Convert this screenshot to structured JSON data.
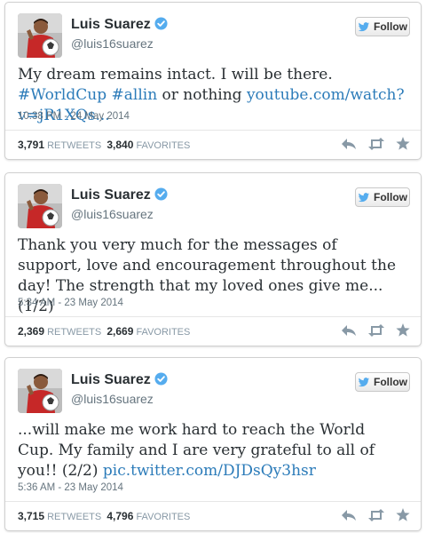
{
  "tweets": [
    {
      "name": "Luis Suarez",
      "handle": "@luis16suarez",
      "follow_label": "Follow",
      "text_parts": [
        {
          "t": "My dream remains intact. I will be there. ",
          "link": false
        },
        {
          "t": "#WorldCup",
          "link": true
        },
        {
          "t": " ",
          "link": false
        },
        {
          "t": "#allin",
          "link": true
        },
        {
          "t": " or nothing ",
          "link": false
        },
        {
          "t": "youtube.com/watch?v=jR1XQs...",
          "link": true
        }
      ],
      "timestamp": "10:38 PM - 24 May 2014",
      "retweets": "3,791",
      "retweets_label": "RETWEETS",
      "favorites": "3,840",
      "favorites_label": "FAVORITES"
    },
    {
      "name": "Luis Suarez",
      "handle": "@luis16suarez",
      "follow_label": "Follow",
      "text_parts": [
        {
          "t": "Thank you very much for the messages of support, love and encouragement throughout the day! The strength that my loved ones give me... (1/2)",
          "link": false
        }
      ],
      "timestamp": "5:34 AM - 23 May 2014",
      "retweets": "2,369",
      "retweets_label": "RETWEETS",
      "favorites": "2,669",
      "favorites_label": "FAVORITES"
    },
    {
      "name": "Luis Suarez",
      "handle": "@luis16suarez",
      "follow_label": "Follow",
      "text_parts": [
        {
          "t": "...will make me work hard to reach the World Cup. My family and I are very grateful to all of you!! (2/2) ",
          "link": false
        },
        {
          "t": "pic.twitter.com/DJDsQy3hsr",
          "link": true
        }
      ],
      "timestamp": "5:36 AM - 23 May 2014",
      "retweets": "3,715",
      "retweets_label": "RETWEETS",
      "favorites": "4,796",
      "favorites_label": "FAVORITES"
    }
  ],
  "icons": {
    "verified": "verified-badge-icon",
    "follow": "twitter-bird-icon",
    "reply": "reply-icon",
    "retweet": "retweet-icon",
    "favorite": "star-icon"
  },
  "colors": {
    "link": "#2b7bb9",
    "verified": "#55acee",
    "follow_bird": "#55acee",
    "icon_gray": "#8899a6"
  }
}
